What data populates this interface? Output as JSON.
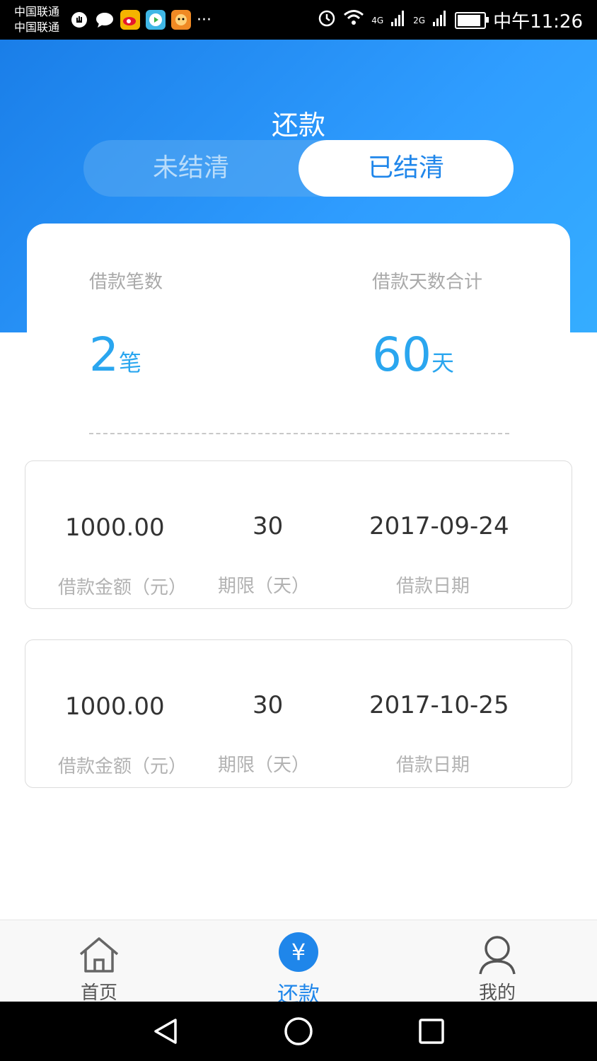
{
  "status_bar": {
    "carrier_1": "中国联通",
    "carrier_2": "中国联通",
    "more": "···",
    "network_1": "4G",
    "network_2": "2G",
    "time": "中午11:26"
  },
  "header": {
    "title": "还款",
    "tabs": [
      {
        "label": "未结清",
        "active": false
      },
      {
        "label": "已结清",
        "active": true
      }
    ]
  },
  "summary": {
    "count_label": "借款笔数",
    "count_value": "2",
    "count_unit": "笔",
    "days_label": "借款天数合计",
    "days_value": "60",
    "days_unit": "天"
  },
  "loans": [
    {
      "amount": "1000.00",
      "amount_label": "借款金额（元）",
      "term": "30",
      "term_label": "期限（天）",
      "date": "2017-09-24",
      "date_label": "借款日期"
    },
    {
      "amount": "1000.00",
      "amount_label": "借款金额（元）",
      "term": "30",
      "term_label": "期限（天）",
      "date": "2017-10-25",
      "date_label": "借款日期"
    }
  ],
  "tab_bar": {
    "home_label": "首页",
    "repay_label": "还款",
    "repay_icon_glyph": "¥",
    "me_label": "我的",
    "active": "repay"
  },
  "colors": {
    "accent": "#2aa6ef",
    "active_tab": "#1f86ea",
    "header_start": "#1a7ee8",
    "header_end": "#35adff"
  }
}
